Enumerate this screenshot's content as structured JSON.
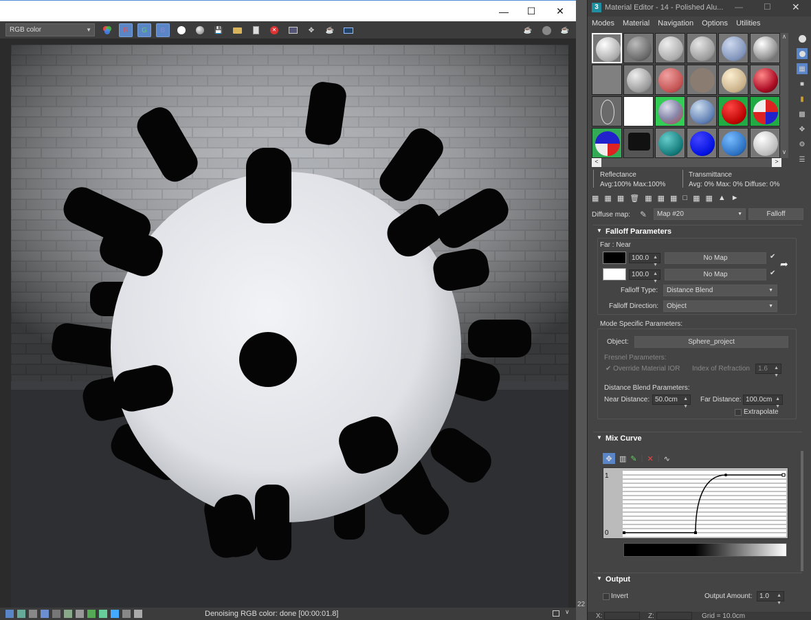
{
  "render": {
    "channel_select": "RGB color",
    "channel_buttons": [
      "R",
      "G",
      "B"
    ],
    "status_text": "Denoising RGB color: done [00:00:01.8]"
  },
  "material_editor": {
    "title": "Material Editor - 14 - Polished Alu...",
    "app_icon": "3",
    "menu": [
      "Modes",
      "Material",
      "Navigation",
      "Options",
      "Utilities"
    ],
    "reflectance": {
      "label": "Reflectance",
      "value": "Avg:100% Max:100%"
    },
    "transmittance": {
      "label": "Transmittance",
      "value": "Avg:   0% Max:   0%  Diffuse:   0%"
    },
    "map_label": "Diffuse map:",
    "map_name": "Map #20",
    "map_type": "Falloff",
    "falloff": {
      "title": "Falloff Parameters",
      "far_near": "Far : Near",
      "row1": {
        "amount": "100.0",
        "map": "No Map"
      },
      "row2": {
        "amount": "100.0",
        "map": "No Map"
      },
      "type_label": "Falloff Type:",
      "type_value": "Distance Blend",
      "direction_label": "Falloff Direction:",
      "direction_value": "Object"
    },
    "mode_specific": {
      "title": "Mode Specific Parameters:",
      "object_label": "Object:",
      "object_value": "Sphere_project",
      "fresnel_label": "Fresnel Parameters:",
      "override_label": "Override Material IOR",
      "ior_label": "Index of Refraction",
      "ior_value": "1.6",
      "distance_label": "Distance Blend Parameters:",
      "near_label": "Near Distance:",
      "near_value": "50.0cm",
      "far_label": "Far Distance:",
      "far_value": "100.0cm",
      "extrapolate_label": "Extrapolate"
    },
    "mix_curve": {
      "title": "Mix Curve",
      "y_top": "1",
      "y_bottom": "0"
    },
    "output": {
      "title": "Output",
      "invert_label": "Invert",
      "amount_label": "Output Amount:",
      "amount_value": "1.0"
    },
    "status": {
      "x_label": "X:",
      "z_label": "Z:",
      "grid": "Grid = 10.0cm"
    },
    "side_number": "22"
  }
}
